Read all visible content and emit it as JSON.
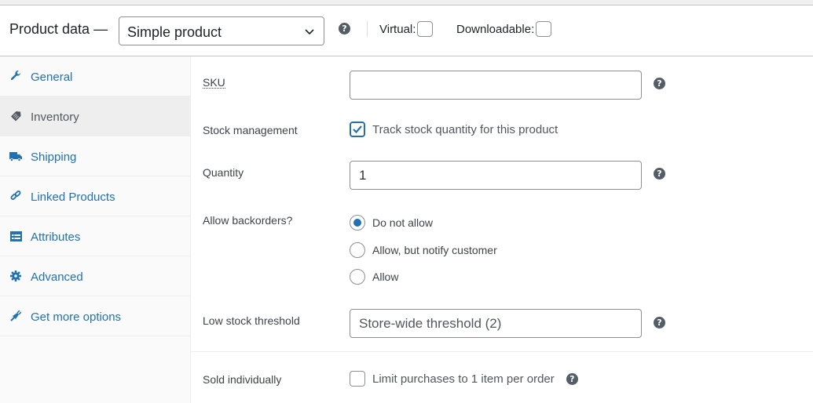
{
  "header": {
    "title": "Product data —",
    "product_type": "Simple product",
    "virtual_label": "Virtual:",
    "virtual_checked": false,
    "downloadable_label": "Downloadable:",
    "downloadable_checked": false,
    "help_glyph": "?"
  },
  "sidebar": {
    "items": [
      {
        "label": "General",
        "icon": "wrench-icon",
        "active": false
      },
      {
        "label": "Inventory",
        "icon": "tag-icon",
        "active": true
      },
      {
        "label": "Shipping",
        "icon": "truck-icon",
        "active": false
      },
      {
        "label": "Linked Products",
        "icon": "link-icon",
        "active": false
      },
      {
        "label": "Attributes",
        "icon": "list-view-icon",
        "active": false
      },
      {
        "label": "Advanced",
        "icon": "gear-icon",
        "active": false
      },
      {
        "label": "Get more options",
        "icon": "plugin-icon",
        "active": false
      }
    ]
  },
  "inventory": {
    "sku": {
      "label": "SKU",
      "value": ""
    },
    "stock_management": {
      "label": "Stock management",
      "checkbox_label": "Track stock quantity for this product",
      "checked": true
    },
    "quantity": {
      "label": "Quantity",
      "value": "1"
    },
    "backorders": {
      "label": "Allow backorders?",
      "options": [
        {
          "label": "Do not allow",
          "selected": true
        },
        {
          "label": "Allow, but notify customer",
          "selected": false
        },
        {
          "label": "Allow",
          "selected": false
        }
      ]
    },
    "low_stock": {
      "label": "Low stock threshold",
      "placeholder": "Store-wide threshold (2)",
      "value": ""
    },
    "sold_individually": {
      "label": "Sold individually",
      "checkbox_label": "Limit purchases to 1 item per order",
      "checked": false
    }
  },
  "colors": {
    "accent": "#2271b1",
    "help_icon": "#555d66",
    "active_tab_bg": "#eeeeee"
  }
}
